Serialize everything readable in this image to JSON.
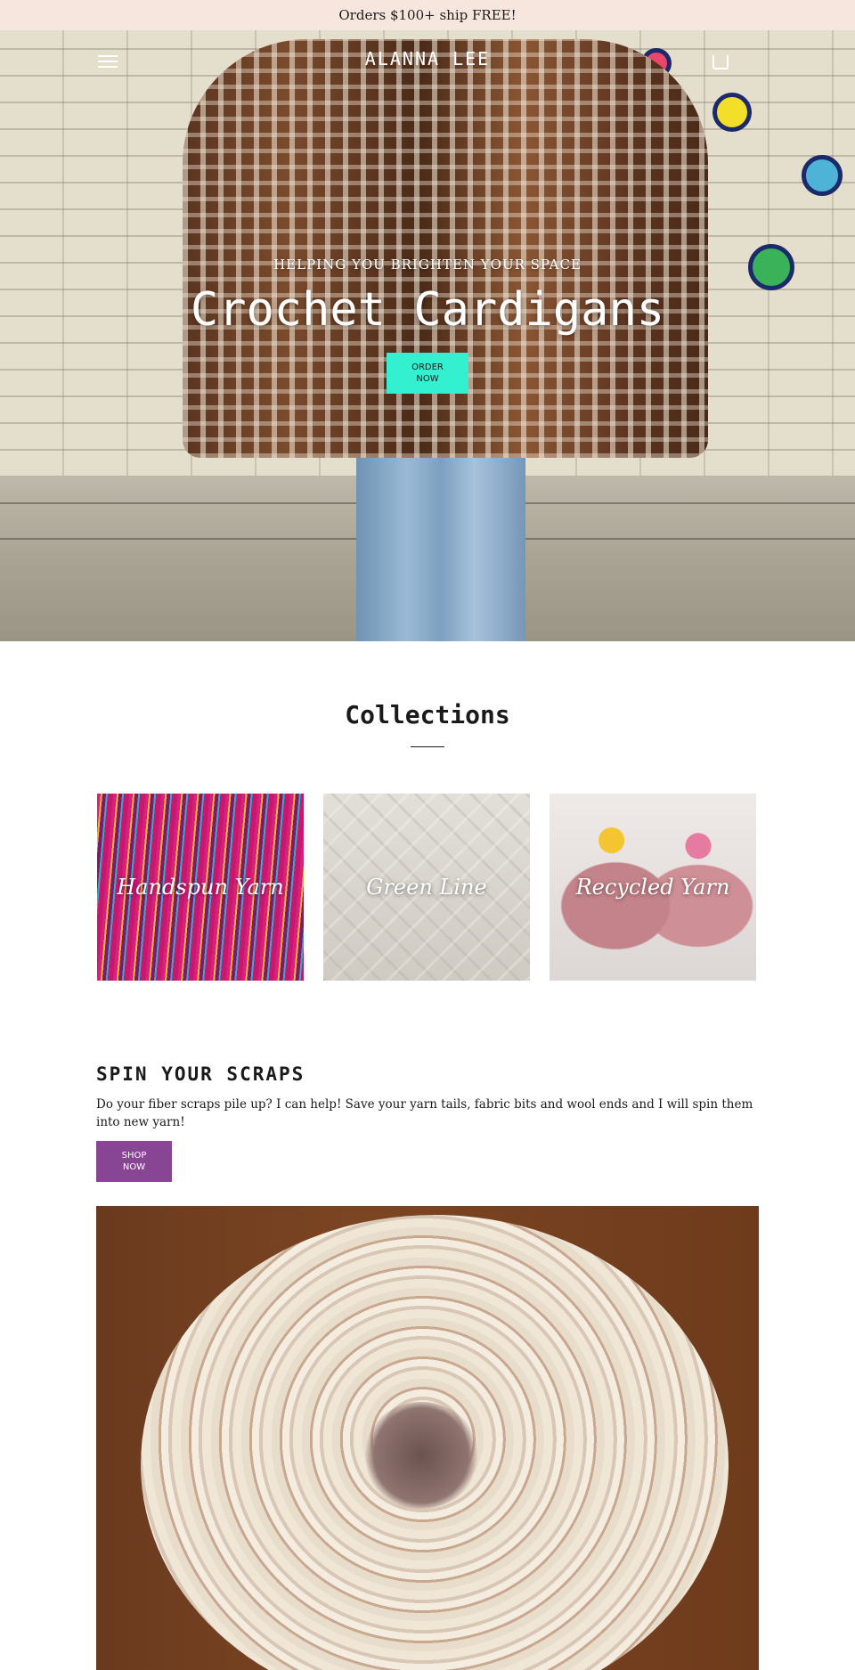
{
  "announcement": {
    "text": "Orders $100+ ship FREE!"
  },
  "header": {
    "brand": "ALANNA LEE",
    "menu_icon": "hamburger-menu-icon",
    "cart_icon": "shopping-bag-icon"
  },
  "hero": {
    "kicker": "HELPING YOU BRIGHTEN YOUR SPACE",
    "title": "Crochet Cardigans",
    "button_label": "ORDER\nNOW",
    "button_color": "#33f0d1"
  },
  "collections": {
    "title": "Collections",
    "items": [
      {
        "label": "Handspun Yarn"
      },
      {
        "label": "Green Line"
      },
      {
        "label": "Recycled Yarn"
      }
    ]
  },
  "spin": {
    "title": "SPIN YOUR SCRAPS",
    "body": "Do your fiber scraps pile up? I can help! Save your yarn tails, fabric bits and wool ends and I will spin them into new yarn!",
    "button_label": "SHOP\nNOW",
    "button_color": "#874594"
  },
  "colors": {
    "announcement_bg": "#f7e6de"
  }
}
